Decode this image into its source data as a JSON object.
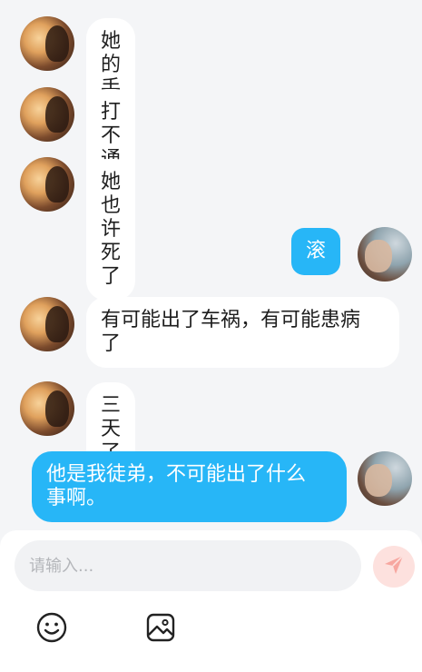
{
  "messages": [
    {
      "text": "她的手机关机了"
    },
    {
      "text": "打不通了"
    },
    {
      "text": "她也许死了"
    },
    {
      "text": "滚"
    },
    {
      "text": "有可能出了车祸，有可能患病\n了"
    },
    {
      "text": "三天了"
    },
    {
      "text": "他是我徒弟，不可能出了什么\n事啊。"
    }
  ],
  "composer": {
    "placeholder": "请输入...",
    "send_color": "#fde1de",
    "send_icon": "paper-plane-icon"
  },
  "toolbar": {
    "emoji_icon": "emoji-icon",
    "image_icon": "image-icon"
  },
  "colors": {
    "outgoing_bubble": "#27b6f7",
    "incoming_bubble": "#ffffff",
    "background": "#f4f5f7"
  }
}
